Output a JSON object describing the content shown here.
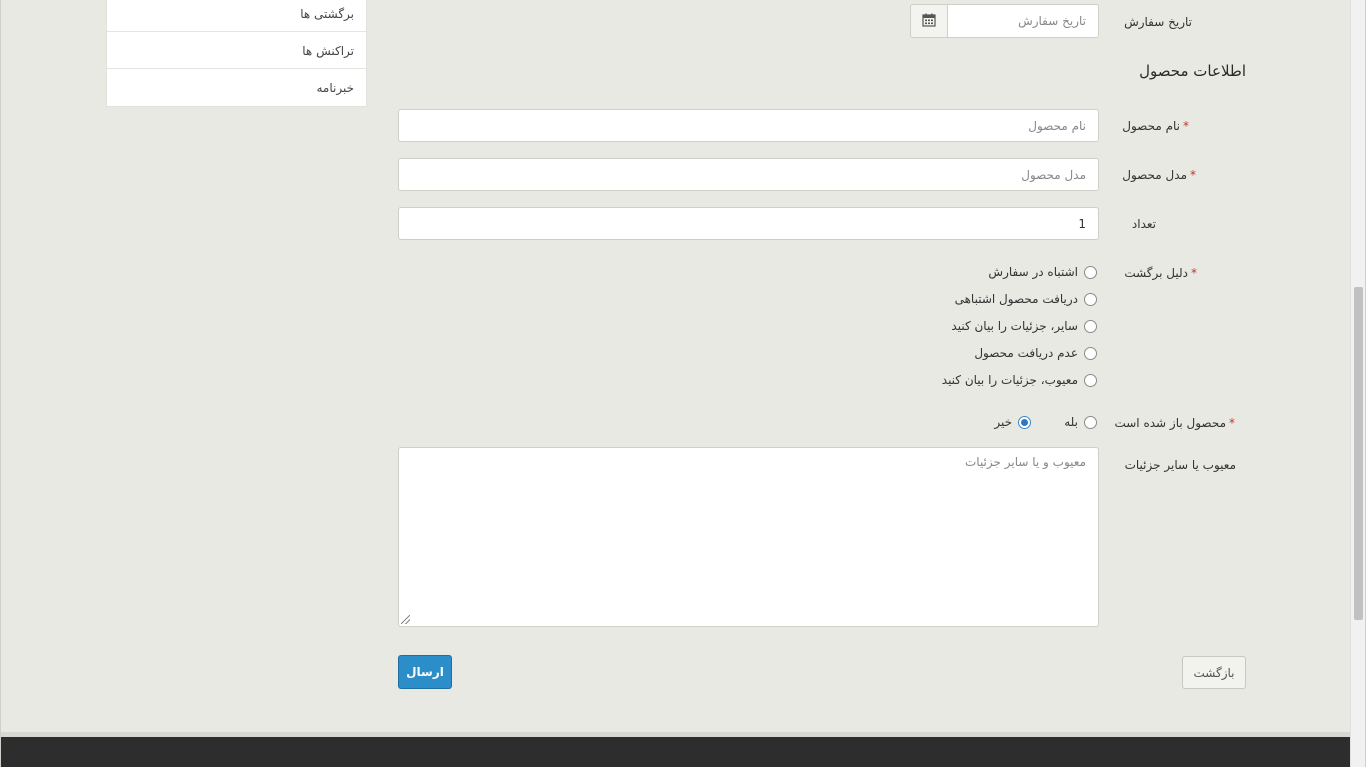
{
  "sidebar": {
    "items": [
      {
        "label": "برگشتی ها"
      },
      {
        "label": "تراکنش ها"
      },
      {
        "label": "خبرنامه"
      }
    ]
  },
  "order_date": {
    "label": "تاریخ سفارش",
    "placeholder": "تاریخ سفارش",
    "icon": "calendar-icon"
  },
  "product_section": {
    "title": "اطلاعات محصول"
  },
  "product_name": {
    "label": "نام محصول",
    "required_mark": "*",
    "placeholder": "نام محصول"
  },
  "product_model": {
    "label": "مدل محصول",
    "required_mark": "*",
    "placeholder": "مدل محصول"
  },
  "quantity": {
    "label": "تعداد",
    "value": "1"
  },
  "return_reason": {
    "label": "دلیل برگشت",
    "required_mark": "*",
    "options": [
      {
        "label": "اشتباه در سفارش",
        "checked": false
      },
      {
        "label": "دریافت محصول اشتباهی",
        "checked": false
      },
      {
        "label": "سایر، جزئیات را بیان کنید",
        "checked": false
      },
      {
        "label": "عدم دریافت محصول",
        "checked": false
      },
      {
        "label": "معیوب، جزئیات را بیان کنید",
        "checked": false
      }
    ]
  },
  "opened": {
    "label": "محصول باز شده است",
    "required_mark": "*",
    "options": [
      {
        "label": "بله",
        "checked": false
      },
      {
        "label": "خیر",
        "checked": true
      }
    ]
  },
  "details": {
    "label": "معیوب یا سایر جزئیات",
    "placeholder": "معیوب و یا سایر جزئیات"
  },
  "actions": {
    "submit_label": "ارسال",
    "back_label": "بازگشت"
  },
  "colors": {
    "page_bg": "#e8e9e2",
    "submit_bg": "#2b8ec9",
    "footer_bg": "#2d2d2d",
    "required": "#c0392b"
  }
}
